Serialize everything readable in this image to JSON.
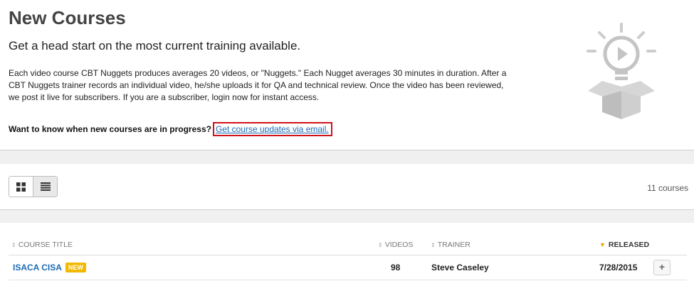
{
  "hero": {
    "title": "New Courses",
    "subtitle": "Get a head start on the most current training available.",
    "description": "Each video course CBT Nuggets produces averages 20 videos, or \"Nuggets.\" Each Nugget averages 30 minutes in duration. After a CBT Nuggets trainer records an individual video, he/she uploads it for QA and technical review. Once the video has been reviewed, we post it live for subscribers. If you are a subscriber, login now for instant access.",
    "cta_text": "Want to know when new courses are in progress?",
    "cta_link": "Get course updates via email."
  },
  "toolbar": {
    "grid_icon": "grid-view-icon",
    "list_icon": "list-view-icon",
    "count": "11 courses"
  },
  "table": {
    "columns": {
      "title": "COURSE TITLE",
      "videos": "VIDEOS",
      "trainer": "TRAINER",
      "released": "RELEASED"
    },
    "rows": [
      {
        "title": "ISACA CISA",
        "badge": "NEW",
        "videos": "98",
        "trainer": "Steve Caseley",
        "released": "7/28/2015",
        "action": "+"
      }
    ]
  },
  "colors": {
    "link": "#1a6bb5",
    "badge": "#f3b800",
    "highlight_border": "#d0121b",
    "sort_arrow": "#e8a000"
  }
}
